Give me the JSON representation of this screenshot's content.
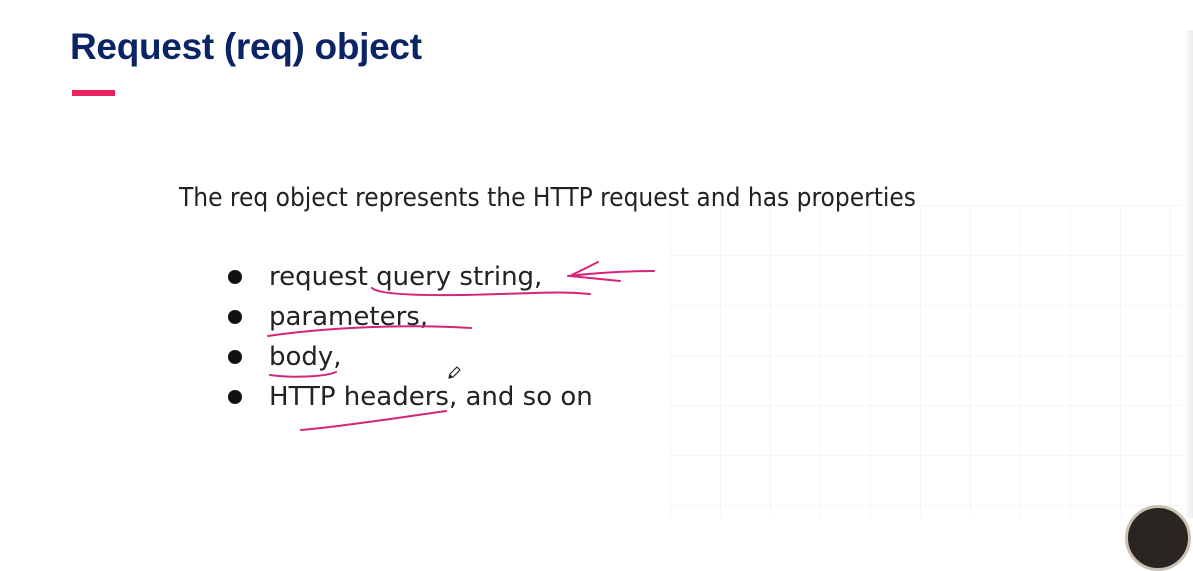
{
  "slide": {
    "title": "Request (req) object",
    "paragraph": "The req object represents the HTTP request and has properties",
    "bullets": [
      "request query string,",
      "parameters,",
      "body,",
      "HTTP headers, and so on"
    ]
  },
  "colors": {
    "title": "#0b2466",
    "accent": "#e8245f",
    "ink_annotation": "#d6247a",
    "body_text": "#222222"
  },
  "icons": {
    "cursor": "pencil-cursor-icon",
    "presenter": "presenter-avatar"
  }
}
